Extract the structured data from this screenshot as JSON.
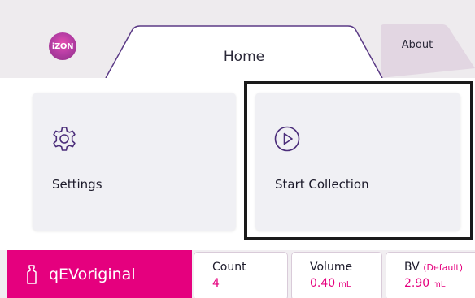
{
  "header": {
    "logo_text": "iZON",
    "tabs": [
      {
        "label": "Home",
        "active": true
      },
      {
        "label": "About",
        "active": false
      }
    ]
  },
  "cards": [
    {
      "label": "Settings",
      "icon": "gear-icon"
    },
    {
      "label": "Start Collection",
      "icon": "play-circle-icon",
      "highlighted": true
    }
  ],
  "bottom_bar": {
    "column_name": "qEVoriginal",
    "column_icon": "bottle-icon",
    "stats": [
      {
        "title": "Count",
        "note": "",
        "value": "4",
        "unit": ""
      },
      {
        "title": "Volume",
        "note": "",
        "value": "0.40",
        "unit": "mL"
      },
      {
        "title": "BV",
        "note": "(Default)",
        "value": "2.90",
        "unit": "mL"
      }
    ]
  },
  "colors": {
    "accent": "#e5007e",
    "icon_purple": "#4b2d7a",
    "tab_outline": "#5b3a86",
    "card_bg": "#f0f0f4"
  }
}
